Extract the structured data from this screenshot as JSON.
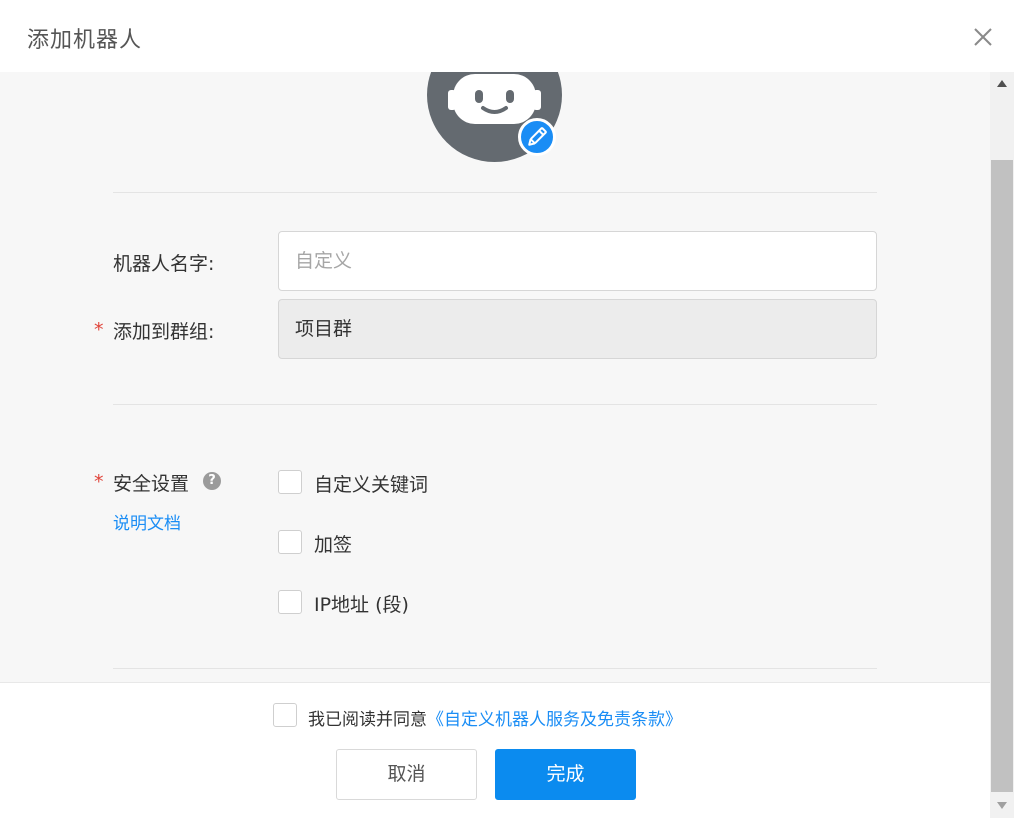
{
  "dialog": {
    "title": "添加机器人",
    "close_icon": "close-icon"
  },
  "avatar": {
    "icon": "robot-icon",
    "edit_icon": "pencil-icon",
    "edit_badge_color": "#1a8df5"
  },
  "form": {
    "name_label": "机器人名字:",
    "name_placeholder": "自定义",
    "name_value": "",
    "group_required_mark": "*",
    "group_label": "添加到群组:",
    "group_value": "项目群",
    "security_required_mark": "*",
    "security_label": "安全设置",
    "security_help_icon": "help-icon",
    "security_help_glyph": "?",
    "doc_link": "说明文档",
    "security_options": [
      {
        "label": "自定义关键词",
        "checked": false
      },
      {
        "label": "加签",
        "checked": false
      },
      {
        "label": "IP地址 (段)",
        "checked": false
      }
    ]
  },
  "footer": {
    "agree_checked": false,
    "agree_prefix": "我已阅读并同意",
    "agree_link": "《自定义机器人服务及免责条款》",
    "cancel_label": "取消",
    "done_label": "完成"
  },
  "colors": {
    "accent": "#0b8bef",
    "required": "#e0443a",
    "link": "#1a8df5"
  }
}
